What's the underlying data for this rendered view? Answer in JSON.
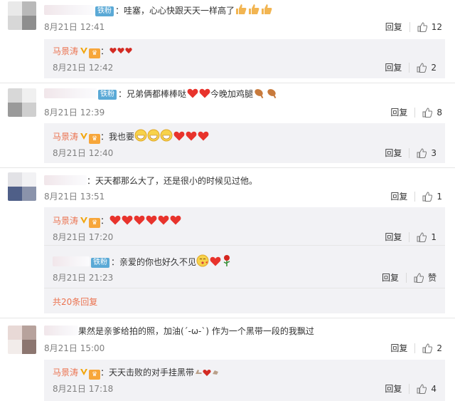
{
  "ui": {
    "reply_label": "回复",
    "author_nick": "马景涛",
    "fan_badge": "铁粉"
  },
  "comments": [
    {
      "text": "：哇塞，心心快跟天天一样高了",
      "date": "8月21日 12:41",
      "likes": "12",
      "reply": {
        "text": "：",
        "date": "8月21日 12:42",
        "likes": "2"
      }
    },
    {
      "text": "：兄弟俩都棒棒哒",
      "text2": "今晚加鸡腿",
      "date": "8月21日 12:39",
      "likes": "8",
      "reply": {
        "text": "：我也要",
        "date": "8月21日 12:40",
        "likes": "3"
      }
    },
    {
      "text": "：天天都那么大了，还是很小的时候见过他。",
      "date": "8月21日 13:51",
      "likes": "1",
      "reply": {
        "text": "：",
        "date": "8月21日 17:20",
        "likes": "1"
      },
      "reply2": {
        "text": "：亲爱的你也好久不见",
        "date": "8月21日 21:23",
        "likes": "赞"
      },
      "more_replies": "共20条回复"
    },
    {
      "text": "果然是亲爹给拍的照，加油(´-ω-`) 作为一个黑带一段的我飘过",
      "date": "8月21日 15:00",
      "likes": "2",
      "reply": {
        "text": "：天天击败的对手挂黑带",
        "date": "8月21日 17:18",
        "likes": "4"
      }
    }
  ]
}
